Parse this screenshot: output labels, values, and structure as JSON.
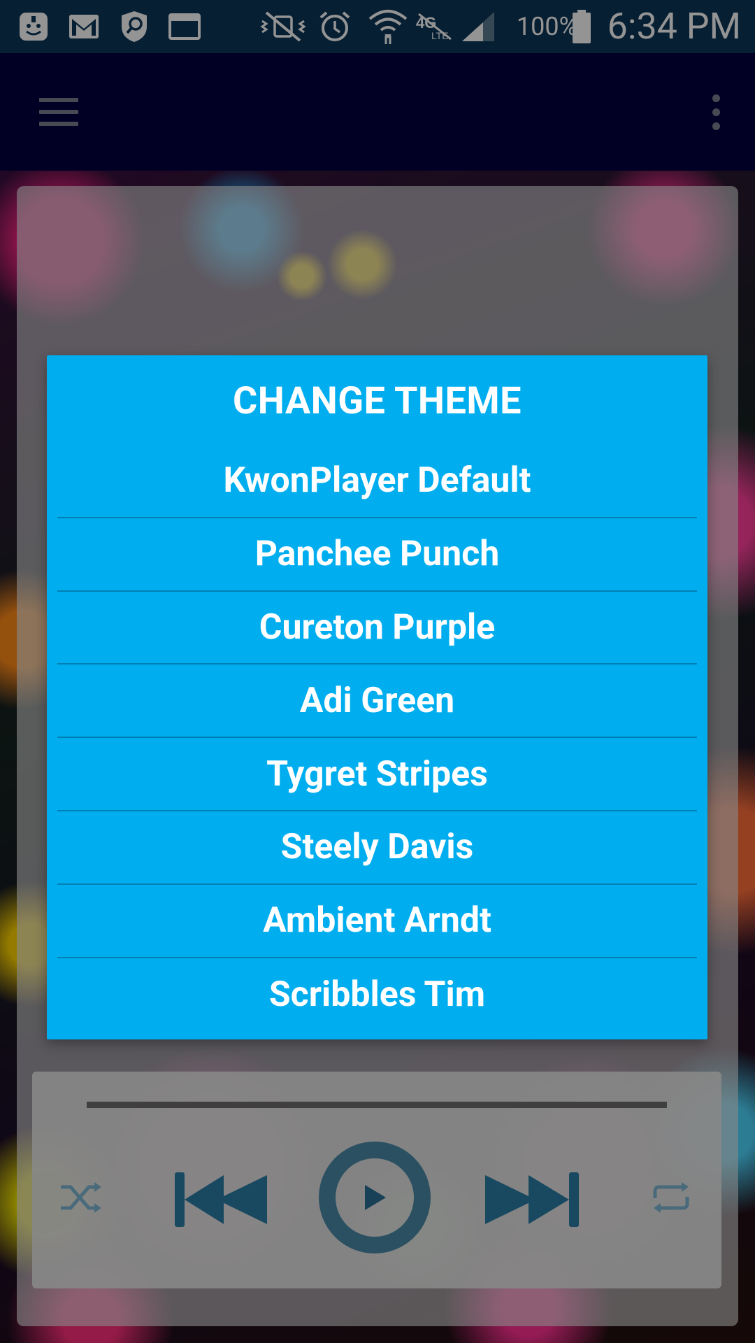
{
  "status_bar": {
    "battery_text": "100%",
    "time": "6:34 PM",
    "icons": [
      "notification-app-icon",
      "gmail-icon",
      "shield-search-icon",
      "window-icon",
      "vibrate-mute-icon",
      "alarm-icon",
      "wifi-icon",
      "lte-icon",
      "signal-icon",
      "battery-icon"
    ]
  },
  "toolbar": {
    "menu_icon": "hamburger-menu-icon",
    "overflow_icon": "more-vert-icon"
  },
  "dialog": {
    "title": "CHANGE THEME",
    "themes": [
      "KwonPlayer Default",
      "Panchee Punch",
      "Cureton Purple",
      "Adi Green",
      "Tygret Stripes",
      "Steely Davis",
      "Ambient Arndt",
      "Scribbles Tim"
    ]
  },
  "player": {
    "controls": [
      "shuffle-icon",
      "previous-icon",
      "play-icon",
      "next-icon",
      "repeat-icon"
    ]
  },
  "colors": {
    "status_bar": "#0c3659",
    "toolbar": "#03003f",
    "dialog": "#00aeef",
    "control_accent": "#2a7fa6"
  }
}
